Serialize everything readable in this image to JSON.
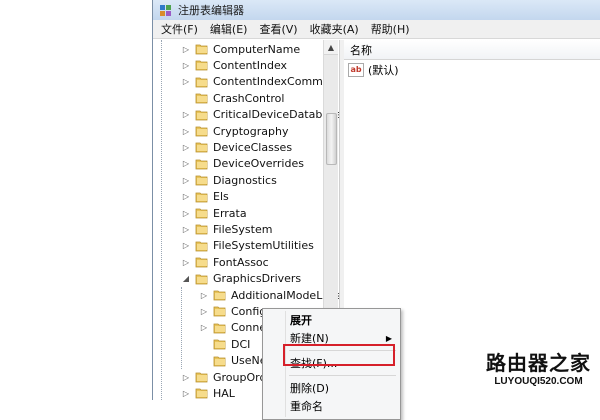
{
  "window": {
    "title": "注册表编辑器"
  },
  "menubar": [
    "文件(F)",
    "编辑(E)",
    "查看(V)",
    "收藏夹(A)",
    "帮助(H)"
  ],
  "tree": {
    "items": [
      {
        "label": "ComputerName",
        "level": 1,
        "expander": "collapsed"
      },
      {
        "label": "ContentIndex",
        "level": 1,
        "expander": "collapsed"
      },
      {
        "label": "ContentIndexCommon",
        "level": 1,
        "expander": "collapsed"
      },
      {
        "label": "CrashControl",
        "level": 1,
        "expander": "none"
      },
      {
        "label": "CriticalDeviceDatabase",
        "level": 1,
        "expander": "collapsed"
      },
      {
        "label": "Cryptography",
        "level": 1,
        "expander": "collapsed"
      },
      {
        "label": "DeviceClasses",
        "level": 1,
        "expander": "collapsed"
      },
      {
        "label": "DeviceOverrides",
        "level": 1,
        "expander": "collapsed"
      },
      {
        "label": "Diagnostics",
        "level": 1,
        "expander": "collapsed"
      },
      {
        "label": "Els",
        "level": 1,
        "expander": "collapsed"
      },
      {
        "label": "Errata",
        "level": 1,
        "expander": "collapsed"
      },
      {
        "label": "FileSystem",
        "level": 1,
        "expander": "collapsed"
      },
      {
        "label": "FileSystemUtilities",
        "level": 1,
        "expander": "collapsed"
      },
      {
        "label": "FontAssoc",
        "level": 1,
        "expander": "collapsed"
      },
      {
        "label": "GraphicsDrivers",
        "level": 1,
        "expander": "expanded"
      },
      {
        "label": "AdditionalModeLists",
        "level": 2,
        "expander": "collapsed"
      },
      {
        "label": "Configura",
        "level": 2,
        "expander": "collapsed"
      },
      {
        "label": "Connect",
        "level": 2,
        "expander": "collapsed"
      },
      {
        "label": "DCI",
        "level": 2,
        "expander": "none"
      },
      {
        "label": "UseNew",
        "level": 2,
        "expander": "none"
      },
      {
        "label": "GroupOrde",
        "level": 1,
        "expander": "collapsed"
      },
      {
        "label": "HAL",
        "level": 1,
        "expander": "collapsed"
      }
    ]
  },
  "list": {
    "header_name": "名称",
    "rows": [
      {
        "icon": "ab-string-icon",
        "name": "(默认)",
        "icon_text": "ab"
      }
    ]
  },
  "context_menu": {
    "items": [
      "展开",
      "新建(N)",
      "查找(F)...",
      "删除(D)",
      "重命名"
    ],
    "highlighted": "查找(F)..."
  },
  "watermark": {
    "title": "路由器之家",
    "url": "LUYOUQI520.COM"
  },
  "colors": {
    "highlight": "#d6202a",
    "folder": "#e8c45a"
  }
}
